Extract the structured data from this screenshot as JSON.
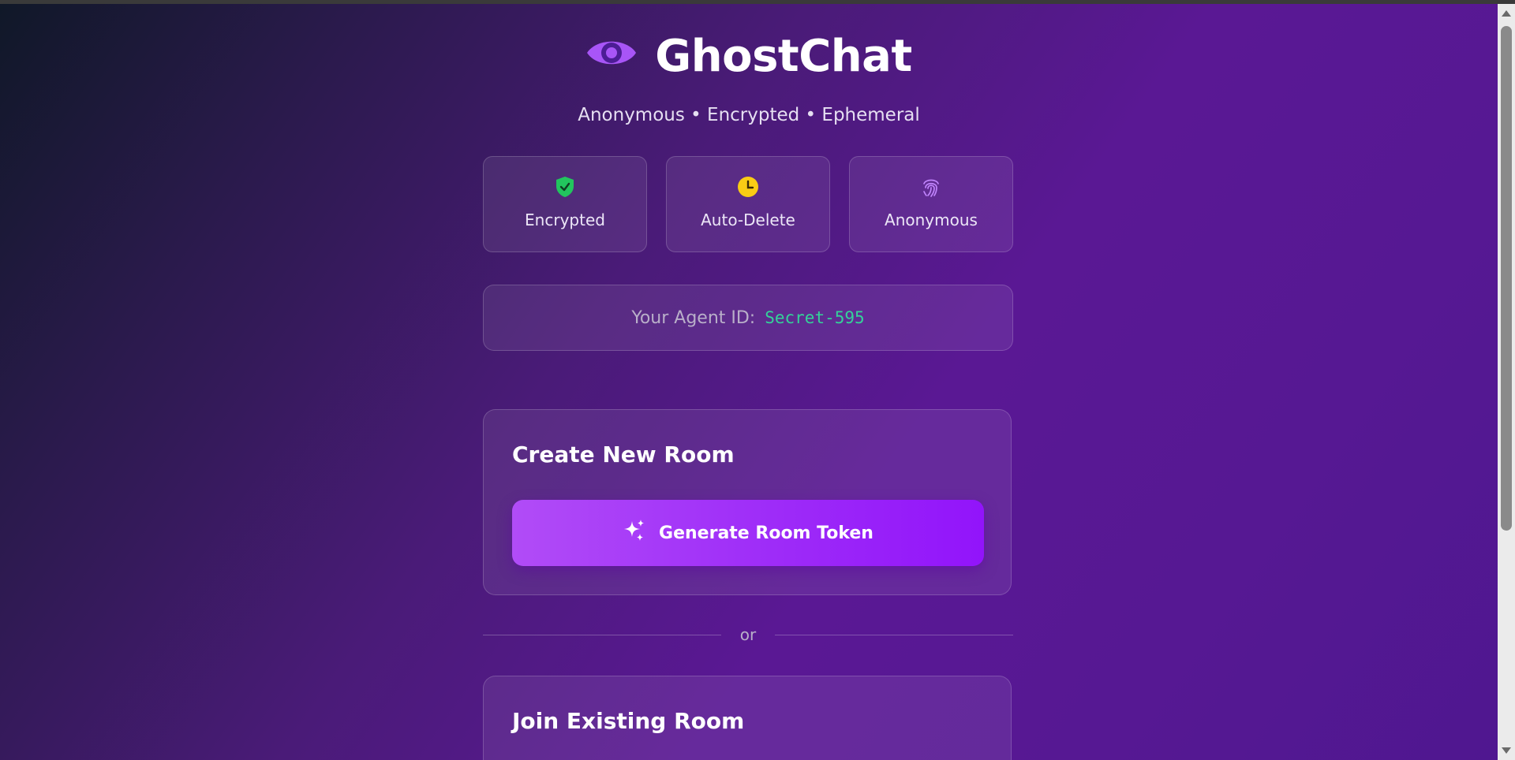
{
  "app": {
    "name": "GhostChat",
    "tagline": "Anonymous • Encrypted • Ephemeral",
    "logo_icon": "eye-icon"
  },
  "features": [
    {
      "label": "Encrypted",
      "icon": "shield-check-icon",
      "color": "#22c55e"
    },
    {
      "label": "Auto-Delete",
      "icon": "clock-icon",
      "color": "#facc15"
    },
    {
      "label": "Anonymous",
      "icon": "fingerprint-icon",
      "color": "#c084fc"
    }
  ],
  "agent": {
    "label": "Your Agent ID:",
    "id": "Secret-595"
  },
  "create_room": {
    "title": "Create New Room",
    "button_label": "Generate Room Token",
    "button_icon": "sparkles-icon"
  },
  "divider_text": "or",
  "join_room": {
    "title": "Join Existing Room"
  },
  "colors": {
    "accent": "#9d27f7",
    "agent_id": "#34d399"
  }
}
